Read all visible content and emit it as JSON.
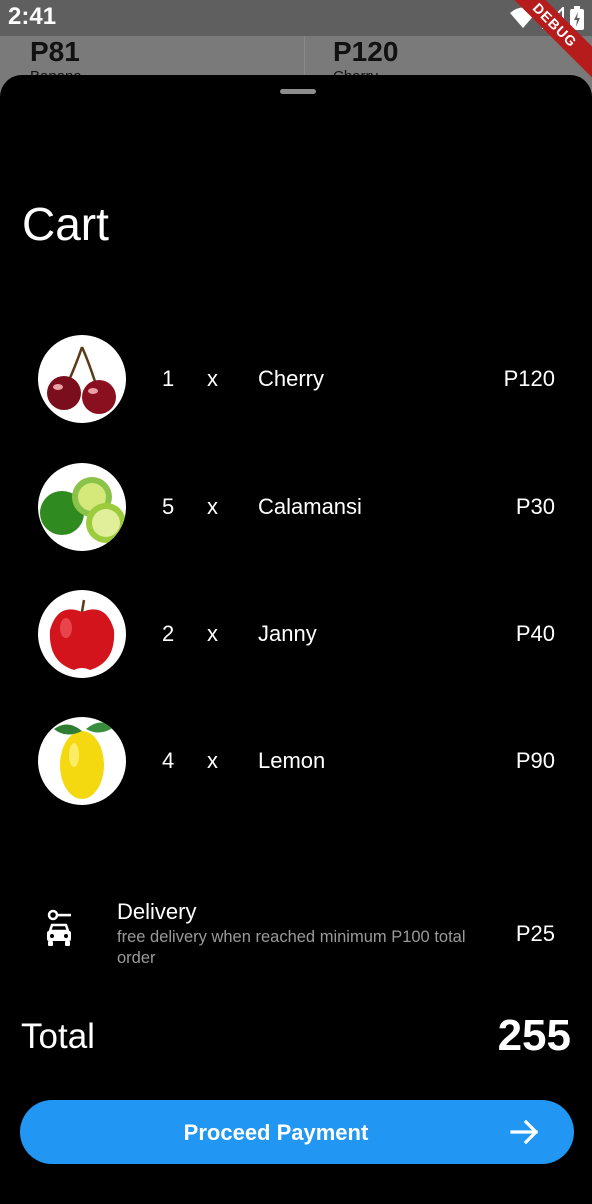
{
  "status_bar": {
    "time": "2:41",
    "debug_label": "DEBUG"
  },
  "background_page": {
    "cards": [
      {
        "price": "P81",
        "name": "Banana"
      },
      {
        "price": "P120",
        "name": "Cherry"
      }
    ]
  },
  "cart": {
    "title": "Cart",
    "items": [
      {
        "qty": "1",
        "x": "x",
        "name": "Cherry",
        "price": "P120",
        "image_icon": "cherry"
      },
      {
        "qty": "5",
        "x": "x",
        "name": "Calamansi",
        "price": "P30",
        "image_icon": "calamansi"
      },
      {
        "qty": "2",
        "x": "x",
        "name": "Janny",
        "price": "P40",
        "image_icon": "apple"
      },
      {
        "qty": "4",
        "x": "x",
        "name": "Lemon",
        "price": "P90",
        "image_icon": "lemon"
      }
    ],
    "delivery": {
      "title": "Delivery",
      "subtitle": "free delivery when reached minimum P100 total order",
      "price": "P25",
      "icon": "car-icon"
    },
    "total": {
      "label": "Total",
      "value": "255"
    },
    "proceed_button": {
      "label": "Proceed Payment",
      "icon": "arrow-right-icon"
    }
  },
  "colors": {
    "accent": "#2196f3",
    "sheet_bg": "#000000",
    "scrim": "#7a7a7a",
    "debug_ribbon": "#b71c1c"
  }
}
